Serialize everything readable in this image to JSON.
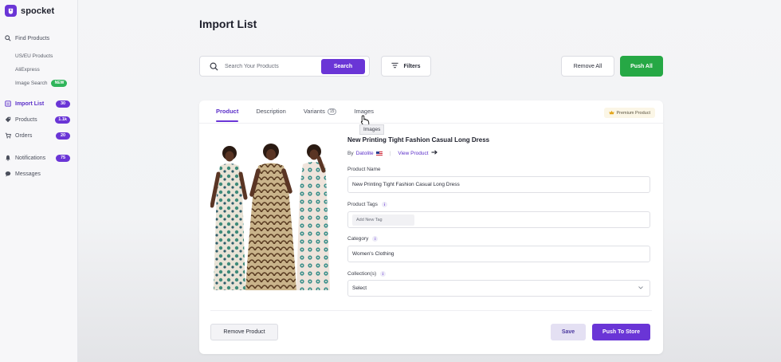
{
  "app": {
    "logo_text": "spocket"
  },
  "sidebar": {
    "find_products": "Find Products",
    "sub_items": [
      {
        "label": "US/EU Products"
      },
      {
        "label": "AliExpress"
      },
      {
        "label": "Image Search",
        "badge": "NEW"
      }
    ],
    "items": [
      {
        "label": "Import List",
        "badge": "30"
      },
      {
        "label": "Products",
        "badge": "1.1k"
      },
      {
        "label": "Orders",
        "badge": "20"
      },
      {
        "label": "Notifications",
        "badge": "75"
      },
      {
        "label": "Messages"
      }
    ]
  },
  "header": {
    "title": "Import List",
    "search_placeholder": "Search Your Products",
    "search_button": "Search",
    "filters_button": "Filters",
    "remove_all_button": "Remove All",
    "push_all_button": "Push All"
  },
  "card": {
    "tabs": [
      {
        "label": "Product"
      },
      {
        "label": "Description"
      },
      {
        "label": "Variants",
        "count": "15"
      },
      {
        "label": "Images"
      }
    ],
    "tooltip": "Images",
    "premium_badge": "Premium Product",
    "product_title": "New Printing Tight Fashion Casual Long Dress",
    "by_prefix": "By",
    "supplier": "Datolite",
    "view_product": "View Product",
    "fields": {
      "product_name_label": "Product Name",
      "product_name_value": "New Printing Tight Fashion Casual Long Dress",
      "product_tags_label": "Product Tags",
      "tag_placeholder": "Add New Tag",
      "category_label": "Category",
      "category_value": "Women's Clothing",
      "collections_label": "Collection(s)",
      "collections_value": "Select"
    },
    "info_icon_glyph": "i",
    "remove_product_button": "Remove Product",
    "save_button": "Save",
    "push_to_store_button": "Push To Store"
  },
  "colors": {
    "brand": "#6a35d6",
    "push_all": "#26a845",
    "badge_new": "#2fb55a"
  }
}
